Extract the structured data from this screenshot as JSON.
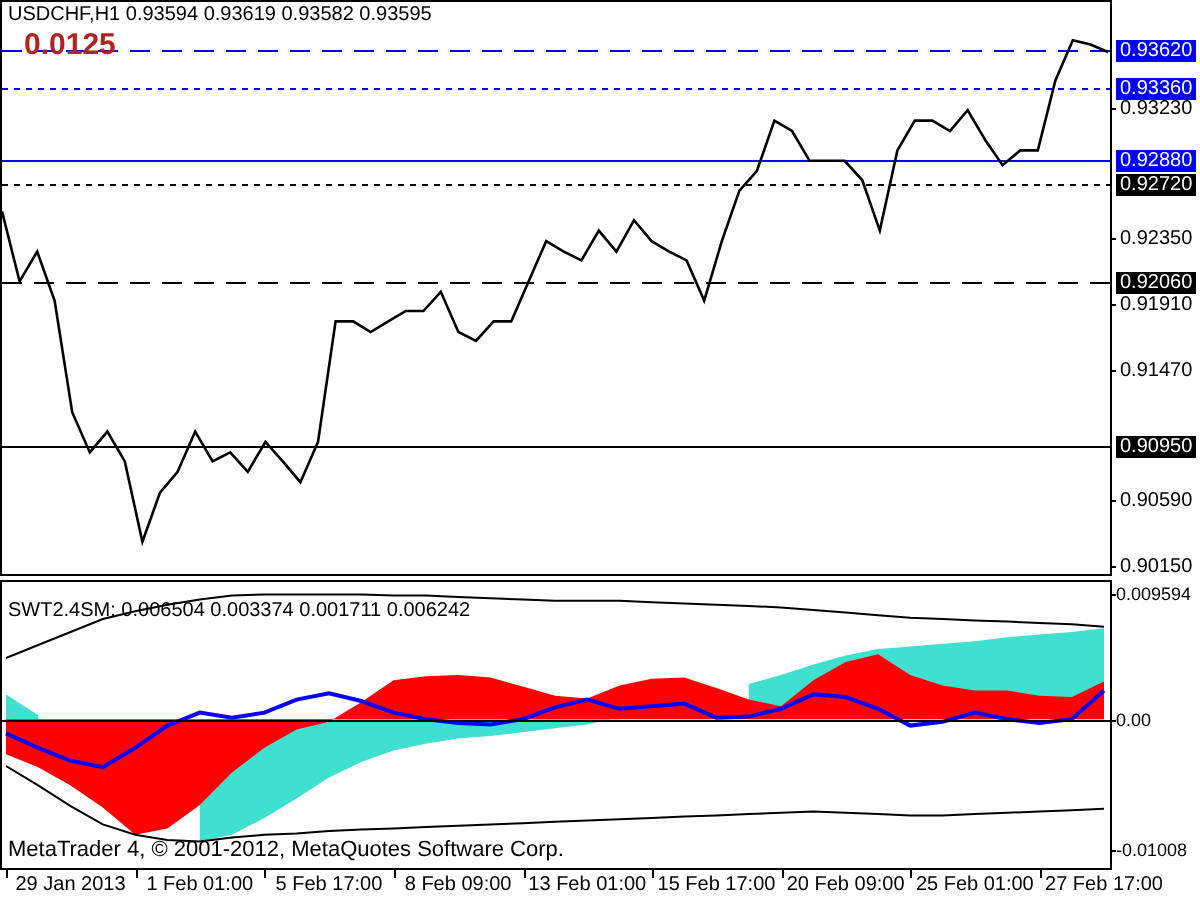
{
  "price_panel": {
    "title": "USDCHF,H1  0.93594 0.93619 0.93582 0.93595",
    "spread": "0.0125",
    "chart_data": {
      "type": "line",
      "ylim": [
        0.9008,
        0.9395
      ],
      "ref_lines": [
        {
          "axis": "y",
          "value": 0.9362,
          "label": "0.93620",
          "color": "#0000ff"
        },
        {
          "axis": "y",
          "value": 0.9336,
          "label": "0.93360",
          "color": "#0000ff"
        },
        {
          "axis": "y",
          "value": 0.9288,
          "label": "0.92880",
          "color": "#0000ff"
        },
        {
          "axis": "y",
          "value": 0.9272,
          "label": "0.92720",
          "color": "#000000"
        },
        {
          "axis": "y",
          "value": 0.9206,
          "label": "0.92060",
          "color": "#000000"
        },
        {
          "axis": "y",
          "value": 0.9095,
          "label": "0.90950",
          "color": "#000000"
        }
      ],
      "yticks": [
        {
          "value": 0.9323,
          "label": "0.93230"
        },
        {
          "value": 0.9235,
          "label": "0.92350"
        },
        {
          "value": 0.9191,
          "label": "0.91910"
        },
        {
          "value": 0.9147,
          "label": "0.91470"
        },
        {
          "value": 0.9059,
          "label": "0.90590"
        },
        {
          "value": 0.9015,
          "label": "0.90150"
        }
      ],
      "categories": [
        null,
        null,
        null,
        null,
        null,
        null,
        null,
        null,
        null,
        null,
        null,
        null,
        null,
        null,
        null,
        null,
        null,
        null,
        null,
        null,
        null,
        null,
        null,
        null,
        null,
        null,
        null,
        null,
        null,
        null,
        null,
        null,
        null,
        null,
        null,
        null,
        null,
        null,
        null,
        null,
        null,
        null,
        null,
        null,
        null,
        null,
        null,
        null,
        null,
        null,
        null,
        null,
        null,
        null,
        null,
        null,
        null,
        null,
        null,
        null,
        null,
        null,
        null,
        null
      ],
      "series": [
        {
          "color": "#000000",
          "values": [
            0.9253,
            0.9206,
            0.9226,
            0.9193,
            0.9118,
            0.9091,
            0.9105,
            0.9085,
            0.9031,
            0.9064,
            0.9078,
            0.9105,
            0.9085,
            0.9091,
            0.9078,
            0.9098,
            0.9085,
            0.9071,
            0.9098,
            0.9179,
            0.9179,
            0.9172,
            0.9179,
            0.9186,
            0.9186,
            0.9199,
            0.9172,
            0.9166,
            0.9179,
            0.9179,
            0.9206,
            0.9233,
            0.9226,
            0.922,
            0.924,
            0.9226,
            0.9247,
            0.9233,
            0.9226,
            0.922,
            0.9193,
            0.9233,
            0.9267,
            0.928,
            0.9314,
            0.9307,
            0.9287,
            0.9287,
            0.9287,
            0.9274,
            0.924,
            0.9294,
            0.9314,
            0.9314,
            0.9307,
            0.9321,
            0.9301,
            0.9284,
            0.9294,
            0.9294,
            0.9341,
            0.9368,
            0.9365,
            0.936
          ]
        }
      ]
    }
  },
  "indicator_panel": {
    "title": "SWT2.4SM:  0.006504 0.003374 0.001711 0.006242",
    "copyright": "MetaTrader 4, © 2001-2012, MetaQuotes Software Corp.",
    "chart_data": {
      "type": "area",
      "ylim": [
        -0.0116,
        0.0107
      ],
      "yticks": [
        {
          "value": 0.009594,
          "label": "0.009594"
        },
        {
          "value": 0,
          "label": "0.00"
        },
        {
          "value": -0.01008,
          "label": "-0.01008"
        }
      ],
      "categories": [
        null,
        null,
        "29 Jan 2013",
        null,
        null,
        null,
        "1 Feb 01:00",
        null,
        null,
        null,
        "5 Feb 17:00",
        null,
        null,
        null,
        "8 Feb 09:00",
        null,
        null,
        null,
        "13 Feb 01:00",
        null,
        null,
        null,
        "15 Feb 17:00",
        null,
        null,
        null,
        "20 Feb 09:00",
        null,
        null,
        null,
        "25 Feb 01:00",
        null,
        null,
        null,
        "27 Feb 17:00"
      ],
      "series": [
        {
          "type": "area",
          "color": "#40e0d0",
          "values": [
            0.0019,
            0.0003,
            null,
            null,
            null,
            null,
            -0.0094,
            -0.0089,
            -0.0076,
            -0.0061,
            -0.0045,
            -0.0033,
            -0.0024,
            -0.0019,
            -0.0015,
            -0.0013,
            -0.001,
            -0.0007,
            -0.0004,
            0.0001,
            null,
            null,
            null,
            0.0027,
            0.0034,
            0.0042,
            0.0049,
            0.0054,
            0.0056,
            0.0058,
            0.006,
            0.0063,
            0.0065,
            0.0067,
            0.007
          ]
        },
        {
          "type": "area",
          "color": "#ff0000",
          "values": [
            -0.0027,
            -0.0037,
            -0.0051,
            -0.0068,
            -0.0089,
            -0.0084,
            -0.0066,
            -0.0041,
            -0.0022,
            -0.0008,
            -0.0002,
            0.0013,
            0.003,
            0.0033,
            0.0034,
            0.0032,
            0.0025,
            0.0018,
            0.0016,
            0.0026,
            0.0031,
            0.0032,
            0.0024,
            0.0015,
            0.001,
            0.003,
            0.0044,
            0.005,
            0.0034,
            0.0026,
            0.0022,
            0.0022,
            0.0018,
            0.0017,
            0.0029
          ]
        },
        {
          "type": "line",
          "color": "#0000ff",
          "values": [
            -0.0011,
            -0.0022,
            -0.0032,
            -0.0037,
            -0.0022,
            -0.0005,
            0.0005,
            0.0001,
            0.0005,
            0.0015,
            0.002,
            0.0014,
            0.0005,
            0,
            -0.0003,
            -0.0004,
            0,
            0.0009,
            0.0015,
            0.0008,
            0.001,
            0.0012,
            0.0001,
            0.0002,
            0.0008,
            0.0019,
            0.0017,
            0.0008,
            -0.0005,
            -0.0002,
            0.0005,
            0,
            -0.0003,
            0,
            0.0022
          ]
        },
        {
          "type": "line",
          "color": "#000000",
          "values": [
            0.0047,
            0.0057,
            0.0067,
            0.0077,
            0.0083,
            0.0088,
            0.0092,
            0.0095,
            0.0096,
            0.0096,
            0.0096,
            0.0096,
            0.0095,
            0.0095,
            0.0094,
            0.0093,
            0.0092,
            0.0091,
            0.0091,
            0.0091,
            0.009,
            0.0089,
            0.0088,
            0.0087,
            0.0086,
            0.0084,
            0.0082,
            0.008,
            0.0078,
            0.0077,
            0.0076,
            0.0075,
            0.0074,
            0.0073,
            0.0071
          ]
        },
        {
          "type": "line",
          "color": "#000000",
          "values": [
            -0.0036,
            -0.0051,
            -0.0067,
            -0.0081,
            -0.0089,
            -0.0093,
            -0.0094,
            -0.0091,
            -0.0089,
            -0.0088,
            -0.0086,
            -0.0085,
            -0.0084,
            -0.0083,
            -0.0082,
            -0.0081,
            -0.008,
            -0.0079,
            -0.0078,
            -0.0077,
            -0.0076,
            -0.0075,
            -0.0074,
            -0.0073,
            -0.0072,
            -0.0071,
            -0.0072,
            -0.0073,
            -0.0074,
            -0.0074,
            -0.0073,
            -0.0072,
            -0.0071,
            -0.007,
            -0.0069
          ]
        }
      ]
    }
  }
}
